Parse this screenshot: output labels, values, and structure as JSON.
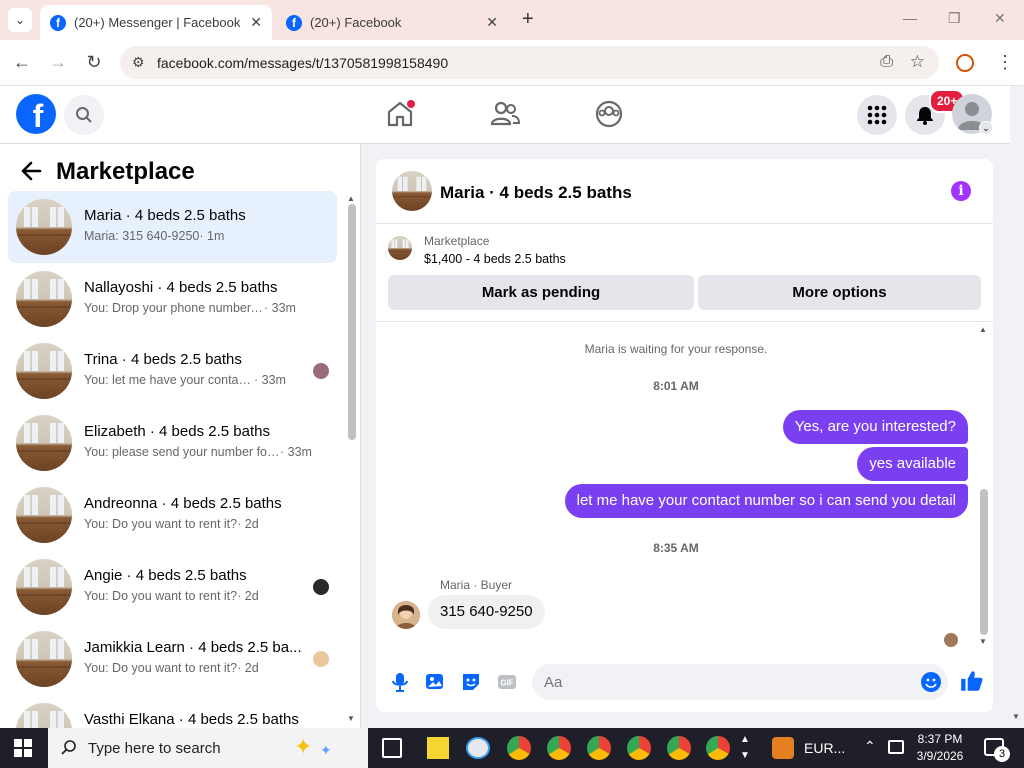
{
  "browser": {
    "tabs": [
      {
        "title": "(20+) Messenger | Facebook",
        "active": true
      },
      {
        "title": "(20+) Facebook",
        "active": false
      }
    ],
    "url": "facebook.com/messages/t/1370581998158490"
  },
  "fb_header": {
    "notification_badge": "20+"
  },
  "sidebar": {
    "title": "Marketplace",
    "conversations": [
      {
        "name": "Maria · 4 beds 2.5 baths",
        "snippet": "Maria: 315 640-9250",
        "time": "· 1m",
        "selected": true
      },
      {
        "name": "Nallayoshi · 4 beds 2.5 baths",
        "snippet": "You: Drop your phone number, a...",
        "time": "· 33m"
      },
      {
        "name": "Trina · 4 beds 2.5 baths",
        "snippet": "You: let me have your contact ...",
        "time": "· 33m"
      },
      {
        "name": "Elizabeth · 4 beds 2.5 baths",
        "snippet": "You: please send your number for...",
        "time": "· 33m"
      },
      {
        "name": "Andreonna · 4 beds 2.5 baths",
        "snippet": "You: Do you want to rent it?",
        "time": "· 2d"
      },
      {
        "name": "Angie · 4 beds 2.5 baths",
        "snippet": "You: Do you want to rent it?",
        "time": "· 2d"
      },
      {
        "name": "Jamikkia Learn · 4 beds 2.5 ba...",
        "snippet": "You: Do you want to rent it?",
        "time": "· 2d"
      },
      {
        "name": "Vasthi Elkana · 4 beds 2.5 baths",
        "snippet": "",
        "time": ""
      }
    ]
  },
  "chat": {
    "title": "Maria · 4 beds 2.5 baths",
    "marketplace_label": "Marketplace",
    "listing": "$1,400 - 4 beds 2.5 baths",
    "mark_pending": "Mark as pending",
    "more_options": "More options",
    "waiting_text": "Maria is waiting for your response.",
    "time1": "8:01 AM",
    "out_messages": [
      "Yes, are you interested?",
      "yes available",
      "let me have your contact number so i can send you detail"
    ],
    "time2": "8:35 AM",
    "sender_label": "Maria · Buyer",
    "in_message": "315 640-9250",
    "composer_placeholder": "Aa"
  },
  "taskbar": {
    "search_placeholder": "Type here to search",
    "currency": "EUR...",
    "time": "8:37 PM",
    "date": "3/9/2026",
    "notifications": "3"
  },
  "colors": {
    "fb_blue": "#0866ff",
    "messenger_purple": "#7b3ff2",
    "badge_red": "#e41e3f"
  }
}
